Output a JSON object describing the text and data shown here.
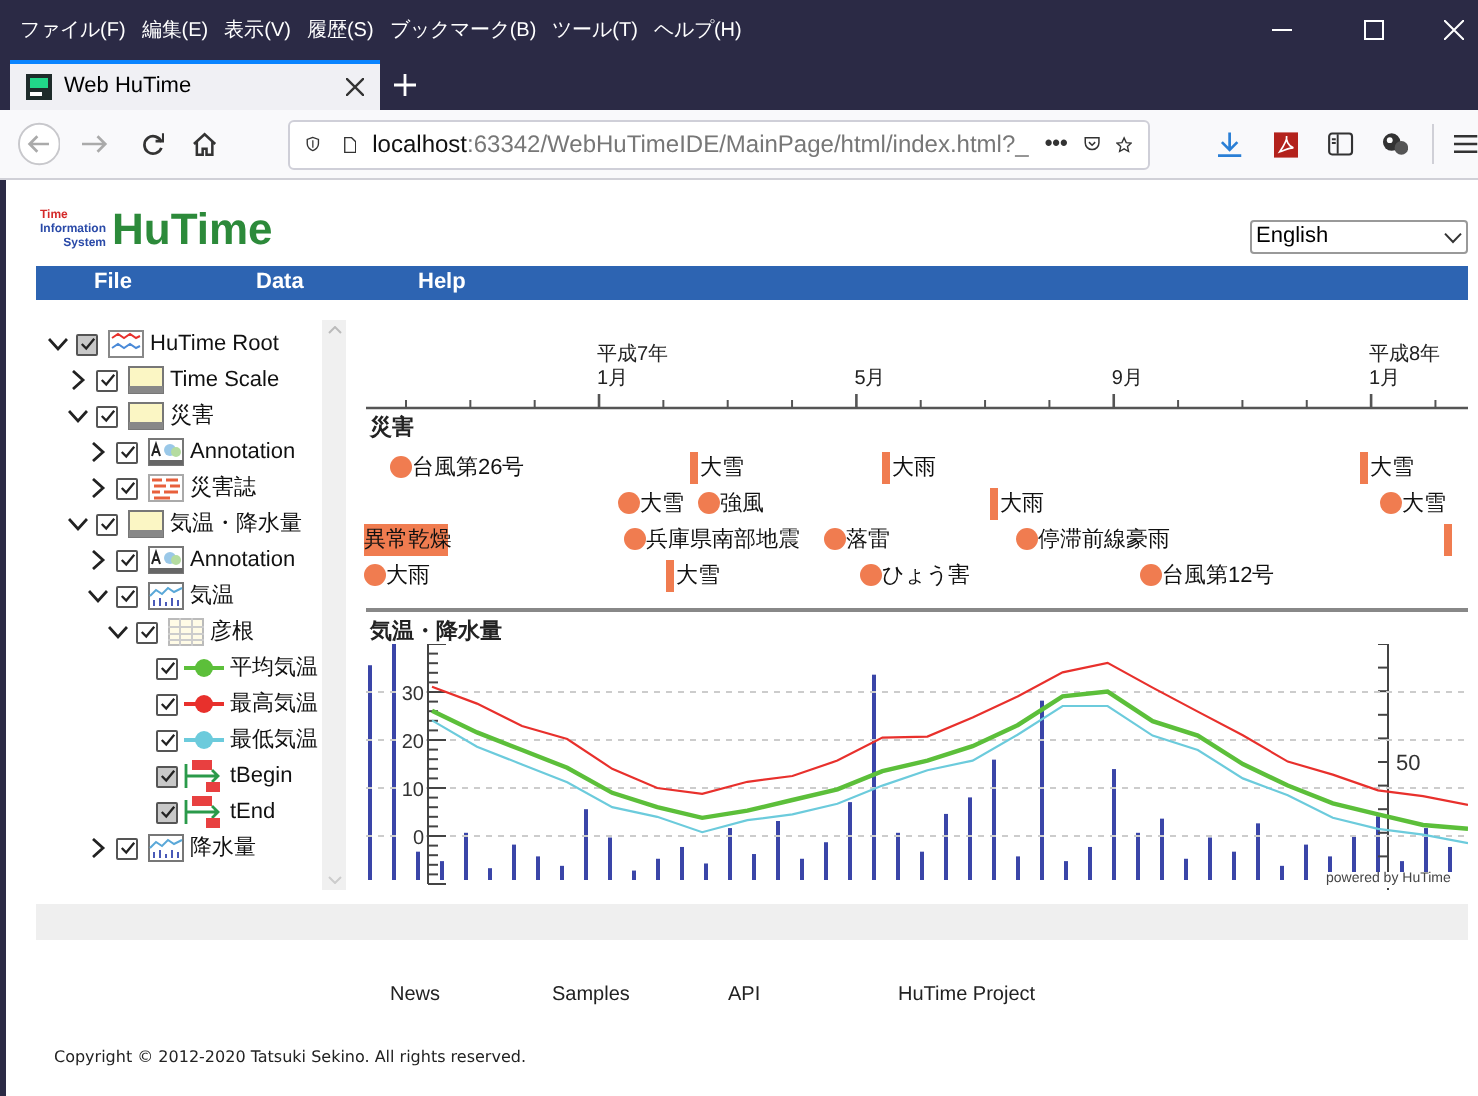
{
  "browser": {
    "menu": [
      "ファイル(F)",
      "編集(E)",
      "表示(V)",
      "履歴(S)",
      "ブックマーク(B)",
      "ツール(T)",
      "ヘルプ(H)"
    ],
    "tab": {
      "title": "Web HuTime",
      "selected": true
    },
    "url": {
      "host": "localhost",
      "rest": ":63342/WebHuTimeIDE/MainPage/html/index.html?_"
    },
    "page_actions": "•••"
  },
  "app": {
    "logo": {
      "small": [
        "Time",
        "Information",
        "System"
      ],
      "name": "HuTime"
    },
    "language": "English",
    "menu": [
      "File",
      "Data",
      "Help"
    ]
  },
  "tree": [
    {
      "label": "HuTime Root",
      "kind": "root",
      "checked": true,
      "disabled": true,
      "expanded": true,
      "children": [
        {
          "label": "Time Scale",
          "kind": "layer",
          "checked": true,
          "disabled": false,
          "expanded": false
        },
        {
          "label": "災害",
          "kind": "layer",
          "checked": true,
          "disabled": false,
          "expanded": true,
          "children": [
            {
              "label": "Annotation",
              "kind": "annotation",
              "checked": true,
              "disabled": false,
              "expanded": false
            },
            {
              "label": "災害誌",
              "kind": "records",
              "checked": true,
              "disabled": false,
              "expanded": false
            }
          ]
        },
        {
          "label": "気温・降水量",
          "kind": "layer",
          "checked": true,
          "disabled": false,
          "expanded": true,
          "children": [
            {
              "label": "Annotation",
              "kind": "annotation",
              "checked": true,
              "disabled": false,
              "expanded": false
            },
            {
              "label": "気温",
              "kind": "chart",
              "checked": true,
              "disabled": false,
              "expanded": true,
              "children": [
                {
                  "label": "彦根",
                  "kind": "table",
                  "checked": true,
                  "disabled": false,
                  "expanded": true,
                  "children": [
                    {
                      "label": "平均気温",
                      "kind": "line",
                      "color": "#5cbf3a",
                      "checked": true,
                      "disabled": false
                    },
                    {
                      "label": "最高気温",
                      "kind": "line",
                      "color": "#e8302c",
                      "checked": true,
                      "disabled": false
                    },
                    {
                      "label": "最低気温",
                      "kind": "line",
                      "color": "#6ccbdc",
                      "checked": true,
                      "disabled": false
                    },
                    {
                      "label": "tBegin",
                      "kind": "from-to",
                      "checked": true,
                      "disabled": true
                    },
                    {
                      "label": "tEnd",
                      "kind": "from-to",
                      "checked": true,
                      "disabled": true
                    }
                  ]
                }
              ]
            },
            {
              "label": "降水量",
              "kind": "chart",
              "checked": true,
              "disabled": false,
              "expanded": false
            }
          ]
        }
      ]
    }
  ],
  "timeline": {
    "axis": [
      {
        "era": "平成7年",
        "month": "1月"
      },
      {
        "month": "5月"
      },
      {
        "month": "9月"
      },
      {
        "era": "平成8年",
        "month": "1月"
      }
    ],
    "disasters": {
      "title": "災害",
      "rows": [
        [
          {
            "label": "台風第26号",
            "kind": "dot"
          },
          {
            "label": "大雪",
            "kind": "bar"
          },
          {
            "label": "大雨",
            "kind": "bar"
          },
          {
            "label": "大雪",
            "kind": "bar"
          }
        ],
        [
          {
            "label": "大雪",
            "kind": "dot"
          },
          {
            "label": "強風",
            "kind": "dot"
          },
          {
            "label": "大雨",
            "kind": "bar"
          },
          {
            "label": "大雪",
            "kind": "dot"
          }
        ],
        [
          {
            "label": "異常乾燥",
            "kind": "range"
          },
          {
            "label": "兵庫県南部地震",
            "kind": "dot"
          },
          {
            "label": "落雷",
            "kind": "dot"
          },
          {
            "label": "停滞前線豪雨",
            "kind": "dot"
          },
          {
            "kind": "bar"
          }
        ],
        [
          {
            "label": "大雨",
            "kind": "dot"
          },
          {
            "label": "大雪",
            "kind": "bar"
          },
          {
            "label": "ひょう害",
            "kind": "dot"
          },
          {
            "label": "台風第12号",
            "kind": "dot"
          }
        ]
      ]
    },
    "weather": {
      "title": "気温・降水量",
      "credit": "powered by HuTime",
      "temperature": {
        "chart_data": {
          "type": "line",
          "ylim": [
            -10,
            40
          ],
          "yticks": [
            0,
            10,
            20,
            30
          ],
          "grid": true,
          "series": [
            {
              "color": "#5cbf3a",
              "values": [
                26.1,
                21.6,
                17.9,
                14.2,
                9,
                6,
                3.8,
                5.3,
                7.5,
                9.7,
                13.5,
                15.7,
                18.7,
                23.1,
                29.1,
                30.1,
                23.9,
                20.9,
                15,
                10.5,
                6.8,
                4.5,
                2.3,
                1.5
              ]
            },
            {
              "color": "#e8302c",
              "values": [
                31.1,
                27.6,
                22.9,
                20.2,
                14,
                10,
                8.8,
                11.3,
                12.5,
                15.7,
                20.5,
                20.7,
                24.7,
                29.1,
                34.1,
                36.1,
                30.9,
                25.9,
                21,
                15.5,
                12.8,
                9.5,
                8.3,
                6.5
              ]
            },
            {
              "color": "#6ccbdc",
              "values": [
                24.1,
                18.6,
                14.9,
                11.2,
                6,
                4,
                0.8,
                3.3,
                4.5,
                6.7,
                10.5,
                13.7,
                15.7,
                21.1,
                27.1,
                27.1,
                20.9,
                17.9,
                12,
                8.5,
                3.8,
                1.5,
                0.3,
                -1.5
              ]
            }
          ]
        }
      },
      "precipitation": {
        "axis_label": "50"
      }
    }
  },
  "footer": {
    "links": [
      "News",
      "Samples",
      "API",
      "HuTime Project"
    ],
    "copyright": "Copyright © 2012-2020 Tatsuki Sekino. All rights reserved."
  }
}
